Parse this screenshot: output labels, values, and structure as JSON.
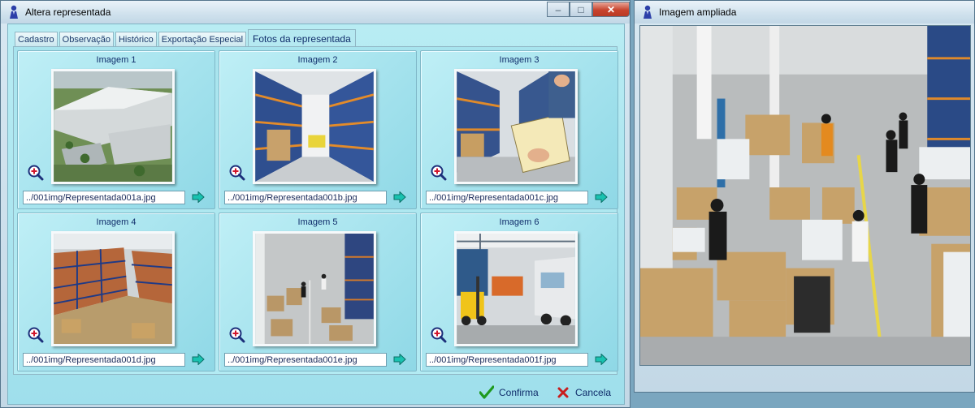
{
  "main_window": {
    "title": "Altera representada",
    "controls": {
      "minimize": "–",
      "maximize": "□",
      "close": "✕"
    },
    "tabs": [
      {
        "label": "Cadastro",
        "active": false
      },
      {
        "label": "Observação",
        "active": false
      },
      {
        "label": "Histórico",
        "active": false
      },
      {
        "label": "Exportação Especial",
        "active": false
      },
      {
        "label": "Fotos da representada",
        "active": true
      }
    ],
    "images": [
      {
        "title": "Imagem 1",
        "path": "../001img/Representada001a.jpg",
        "scene": "aerial-warehouse"
      },
      {
        "title": "Imagem 2",
        "path": "../001img/Representada001b.jpg",
        "scene": "rack-aisle"
      },
      {
        "title": "Imagem 3",
        "path": "../001img/Representada001c.jpg",
        "scene": "clipboard-aisle"
      },
      {
        "title": "Imagem 4",
        "path": "../001img/Representada001d.jpg",
        "scene": "high-racks"
      },
      {
        "title": "Imagem 5",
        "path": "../001img/Representada001e.jpg",
        "scene": "workers-floor"
      },
      {
        "title": "Imagem 6",
        "path": "../001img/Representada001f.jpg",
        "scene": "forklift-truck"
      }
    ],
    "icons": {
      "zoom": "magnifier-plus-icon",
      "go": "arrow-right-icon"
    },
    "buttons": {
      "confirm_label": "Confirma",
      "cancel_label": "Cancela"
    }
  },
  "zoom_window": {
    "title": "Imagem ampliada"
  },
  "colors": {
    "panel": "#a8e4ee",
    "title_text": "#0f2c6a",
    "confirm_icon": "#1e9a1e",
    "cancel_icon": "#c81e1e"
  }
}
